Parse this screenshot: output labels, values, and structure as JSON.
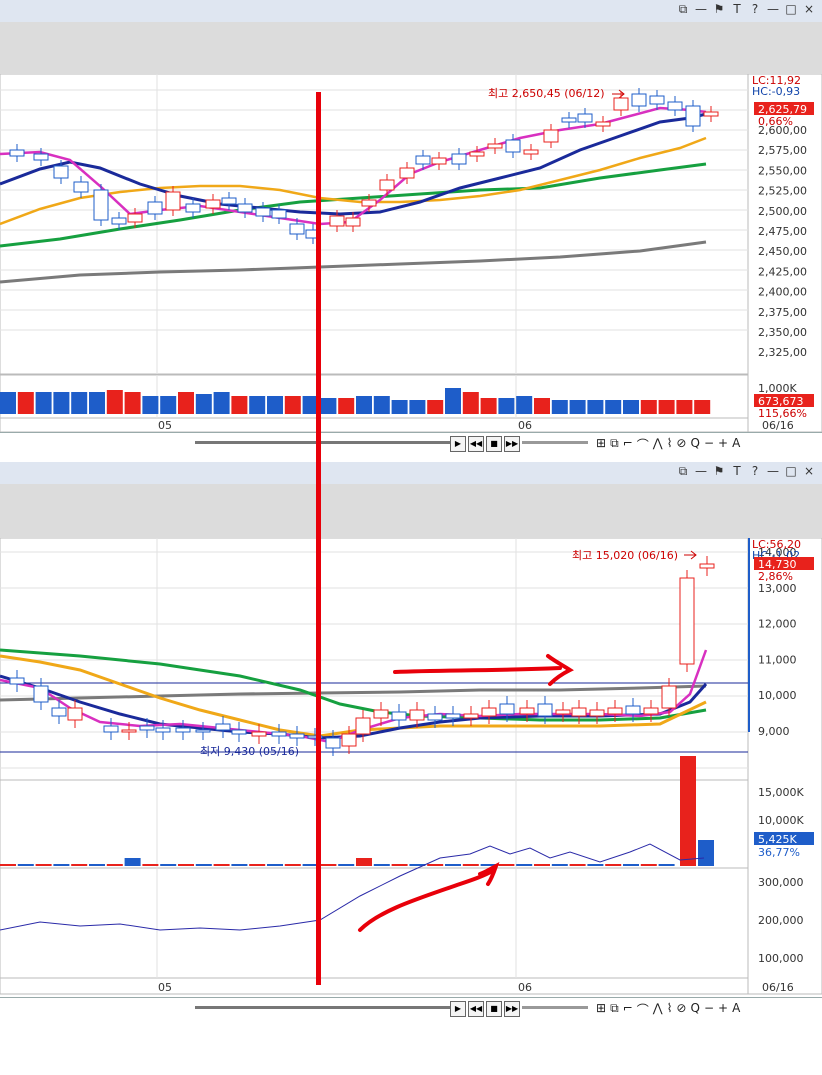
{
  "window_controls": [
    "restore-icon",
    "minimize-icon",
    "pin-icon",
    "text-icon",
    "help-icon",
    "min-icon",
    "max-icon",
    "close-icon"
  ],
  "window_glyphs": [
    "⧉",
    "—",
    "⚑",
    "T",
    "?",
    "—",
    "□",
    "×"
  ],
  "top": {
    "y_ticks": [
      "2,600,00",
      "2,575,00",
      "2,550,00",
      "2,525,00",
      "2,500,00",
      "2,475,00",
      "2,450,00",
      "2,425,00",
      "2,400,00",
      "2,375,00",
      "2,350,00",
      "2,325,00"
    ],
    "lc": "LC:11,92",
    "hc": "HC:-0,93",
    "price_tag": "2,625,79",
    "pct": "0,66%",
    "high_annotation": "최고 2,650,45 (06/12)",
    "volume_k": "1,000K",
    "volume_tag": "673,673",
    "volume_pct": "115,66%",
    "x_labels": [
      "05",
      "06"
    ],
    "date_label": "06/16"
  },
  "bottom": {
    "y_ticks": [
      "14,000",
      "13,000",
      "12,000",
      "11,000",
      "10,000",
      "9,000"
    ],
    "lc": "LC:56,20",
    "hc": "HC:-1,02",
    "price_tag": "14,730",
    "pct": "2,86%",
    "high_annotation": "최고 15,020 (06/16)",
    "low_annotation": "최저 9,430 (05/16)",
    "vol_ticks": [
      "15,000K",
      "10,000K"
    ],
    "volume_tag": "5,425K",
    "volume_pct": "36,77%",
    "ind_ticks": [
      "300,000",
      "200,000",
      "100,000"
    ],
    "x_labels": [
      "05",
      "06"
    ],
    "date_label": "06/16"
  },
  "nav_glyphs": [
    "▶",
    "◀◀",
    "■",
    "▶▶"
  ],
  "tool_glyphs": [
    "⊞",
    "⧉",
    "⌐",
    "⌒",
    "⋀",
    "⌇",
    "⊘",
    "Q",
    "−",
    "+",
    "A"
  ],
  "colors": {
    "up": "#e8221c",
    "down": "#1e5dc9",
    "ma5": "#d830c0",
    "ma20": "#1a2a9a",
    "ma60": "#f0a818",
    "ma120": "#16a040",
    "ma240": "#7a7a7a",
    "marker": "#e8000a"
  }
}
